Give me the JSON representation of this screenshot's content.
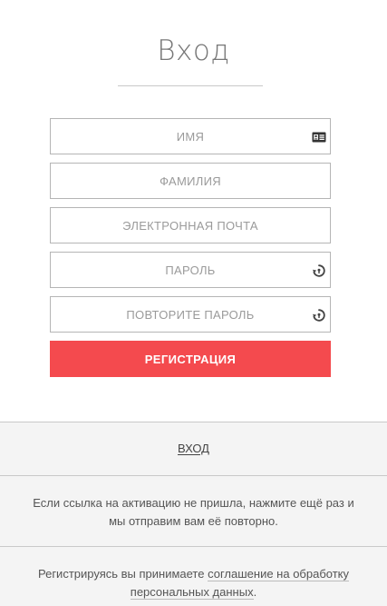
{
  "page": {
    "title": "Вход"
  },
  "form": {
    "first_name": {
      "placeholder": "ИМЯ",
      "value": ""
    },
    "last_name": {
      "placeholder": "ФАМИЛИЯ",
      "value": ""
    },
    "email": {
      "placeholder": "ЭЛЕКТРОННАЯ ПОЧТА",
      "value": ""
    },
    "password": {
      "placeholder": "ПАРОЛЬ",
      "value": ""
    },
    "password_repeat": {
      "placeholder": "ПОВТОРИТЕ ПАРОЛЬ",
      "value": ""
    },
    "submit_label": "РЕГИСТРАЦИЯ"
  },
  "icons": {
    "first_name": "id-card-icon",
    "password": "password-generate-icon",
    "password_repeat": "password-generate-icon"
  },
  "footer": {
    "login_link": "ВХОД",
    "activation_text_1": "Если ссылка на активацию не пришла, ",
    "activation_link": "нажмите ещё раз",
    "activation_text_2": " и мы отправим вам её повторно.",
    "consent_text_1": "Регистрируясь вы принимаете ",
    "consent_link": "соглашение на обработку персональных данных",
    "consent_text_2": "."
  },
  "colors": {
    "accent": "#f44a4e",
    "footer_bg": "#f4f4f4",
    "border": "#b5b5b5"
  }
}
